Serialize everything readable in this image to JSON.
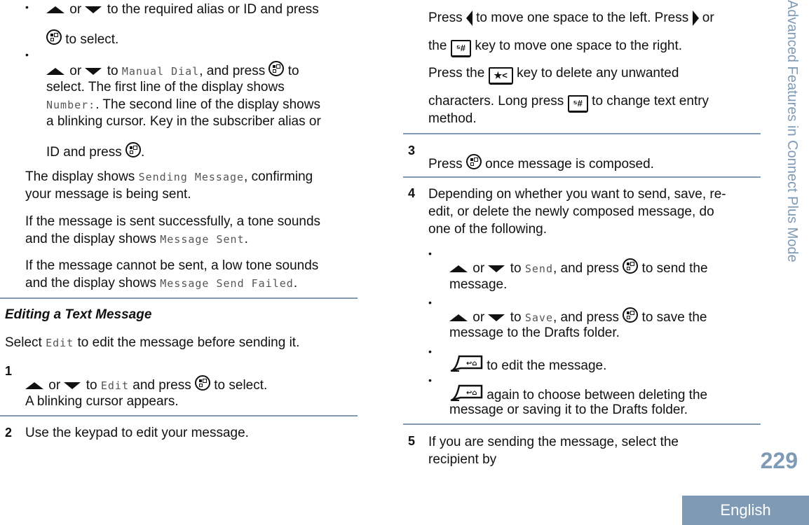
{
  "left_column": {
    "bullet1": {
      "line1_a": " or ",
      "line1_b": " to the required alias or ID and press",
      "line2": " to select."
    },
    "bullet2": {
      "line1_a": " or ",
      "line1_b": " to ",
      "line1_mono": "Manual Dial",
      "line1_c": ", and press ",
      "line1_d": " to",
      "line2": "select. The first line of the display shows",
      "line3_mono": "Number:",
      "line3": ". The second line of the display shows",
      "line4": "a blinking cursor. Key in the subscriber alias or",
      "line5": "ID and press ",
      "line5_end": "."
    },
    "para1": {
      "line1_a": "The display shows ",
      "line1_mono": "Sending Message",
      "line1_b": ", confirming",
      "line2": "your message is being sent."
    },
    "para2": {
      "line1": "If the message is sent successfully, a tone sounds",
      "line2_a": "and the display shows ",
      "line2_mono": "Message Sent",
      "line2_b": "."
    },
    "para3": {
      "line1": "If the message cannot be sent, a low tone sounds",
      "line2_a": "and the display shows ",
      "line2_mono": "Message Send Failed",
      "line2_b": "."
    },
    "section_heading": "Editing a Text Message",
    "intro_a": "Select ",
    "intro_mono": "Edit",
    "intro_b": " to edit the message before sending it.",
    "step1": {
      "number": "1",
      "line1_a": " or ",
      "line1_b": " to ",
      "line1_mono": "Edit",
      "line1_c": " and press ",
      "line1_d": " to select.",
      "line2": "A blinking cursor appears."
    },
    "step2": {
      "number": "2",
      "text": "Use the keypad to edit your message."
    }
  },
  "right_column": {
    "cont": {
      "line1_a": "Press ",
      "line1_b": " to move one space to the left. Press ",
      "line1_c": " or",
      "line2_a": "the ",
      "line2_b": " key to move one space to the right.",
      "line3_a": "Press the ",
      "line3_b": " key to delete any unwanted",
      "line4_a": "characters. Long press ",
      "line4_b": " to change text entry",
      "line5": "method.",
      "hash_key_label": "⁵#",
      "star_key_label": "★<"
    },
    "step3": {
      "number": "3",
      "text_a": "Press ",
      "text_b": " once message is composed."
    },
    "step4": {
      "number": "4",
      "line1": "Depending on whether you want to send, save, re-",
      "line2": "edit, or delete the newly composed message, do",
      "line3": "one of the following.",
      "options": [
        {
          "a": " or ",
          "b": " to ",
          "mono": "Send",
          "c": ", and press ",
          "d": " to send the",
          "line2": "message."
        },
        {
          "a": " or ",
          "b": " to ",
          "mono": "Save",
          "c": ", and press ",
          "d": " to save the",
          "line2": "message to the Drafts folder."
        },
        {
          "text": " to edit the message."
        },
        {
          "text": " again to choose between deleting the",
          "line2": "message or saving it to the Drafts folder."
        }
      ]
    },
    "step5": {
      "number": "5",
      "line1": "If you are sending the message, select the",
      "line2": "recipient by"
    }
  },
  "sidebar": {
    "chapter_title": "Advanced Features in Connect Plus Mode"
  },
  "footer": {
    "page_number": "229",
    "language": "English"
  },
  "colors": {
    "accent": "#7f9ab4",
    "text": "#111111",
    "mono_text": "#555555"
  }
}
